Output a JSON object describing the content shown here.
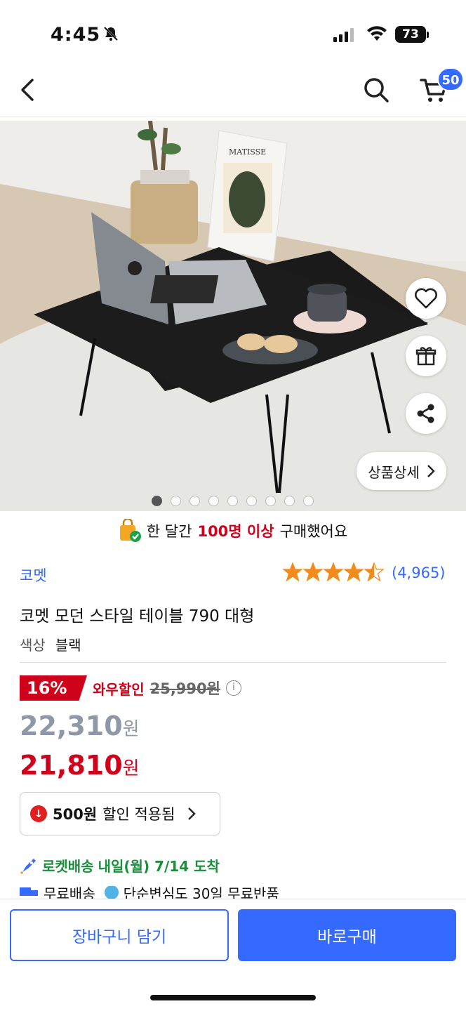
{
  "status_bar": {
    "time": "4:45",
    "battery": "73"
  },
  "nav": {
    "cart_count": "50"
  },
  "hero": {
    "poster_text": "MATISSE",
    "detail_button": "상품상세",
    "dots_total": 9,
    "dots_active": 0
  },
  "banner": {
    "prefix": "한 달간",
    "highlight": "100명 이상",
    "suffix": "구매했어요"
  },
  "product": {
    "brand": "코멧",
    "rating": 4.5,
    "reviews": "(4,965)",
    "title": "코멧 모던 스타일 테이블 790 대형",
    "option_label": "색상",
    "option_value": "블랙"
  },
  "pricing": {
    "discount_badge": "16%",
    "sale_label": "와우할인",
    "original_price": "25,990원",
    "price": "22,310",
    "price_unit": "원",
    "wow_price": "21,810",
    "wow_unit": "원"
  },
  "coupon": {
    "amount": "500원",
    "text": "할인 적용됨"
  },
  "delivery": {
    "rocket_label": "로켓배송",
    "arrival": "내일(월) 7/14 도착",
    "free_shipping": "무료배송",
    "return_policy": "단순변심도 30일 무료반품"
  },
  "actions": {
    "cart_button": "장바구니 담기",
    "buy_button": "바로구매"
  },
  "colors": {
    "accent": "#346aff",
    "sale": "#d0021b",
    "rocket": "#1a8f3c"
  }
}
